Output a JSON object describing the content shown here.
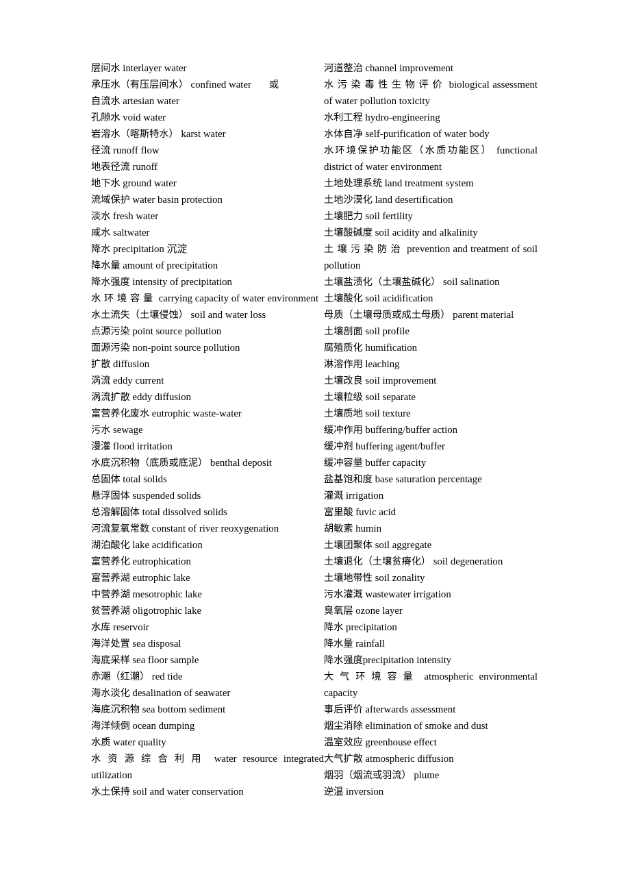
{
  "document": {
    "type": "bilingual-glossary",
    "title_visible": false,
    "page_background": "#ffffff",
    "text_color": "#000000",
    "columns": 2
  },
  "left_column": {
    "name": "left-glossary-column",
    "entries": [
      {
        "zh": "层间水",
        "en": "interlayer water"
      },
      {
        "zh": "承压水（有压层间水）",
        "en": "confined water",
        "trailing_zh": "或",
        "spread": false
      },
      {
        "zh": "自流水",
        "en": "artesian water"
      },
      {
        "zh": "孔隙水",
        "en": "void water"
      },
      {
        "zh": "岩溶水（喀斯特水）",
        "en": "karst water"
      },
      {
        "zh": "径流",
        "en": "runoff flow"
      },
      {
        "zh": "地表径流",
        "en": "runoff"
      },
      {
        "zh": "地下水",
        "en": "ground water"
      },
      {
        "zh": "流域保护",
        "en": "water basin protection"
      },
      {
        "zh": "淡水",
        "en": "fresh water"
      },
      {
        "zh": "咸水",
        "en": "saltwater"
      },
      {
        "zh": "降水",
        "en": "precipitation 沉淀"
      },
      {
        "zh": "降水量",
        "en": "amount of precipitation"
      },
      {
        "zh": "降水强度",
        "en": "intensity of precipitation"
      },
      {
        "zh": "水环境容量",
        "en": "carrying capacity of water environment",
        "spread": true
      },
      {
        "zh": "水土流失（土壤侵蚀）",
        "en": "soil and water loss"
      },
      {
        "zh": "点源污染",
        "en": "point source pollution"
      },
      {
        "zh": "面源污染",
        "en": "non-point source pollution"
      },
      {
        "zh": "扩散",
        "en": "diffusion"
      },
      {
        "zh": "涡流",
        "en": "eddy current"
      },
      {
        "zh": "涡流扩散",
        "en": "eddy diffusion"
      },
      {
        "zh": "富营养化废水",
        "en": "eutrophic waste-water"
      },
      {
        "zh": "污水",
        "en": "sewage"
      },
      {
        "zh": "漫灌",
        "en": "flood irritation"
      },
      {
        "zh": "水底沉积物（底质或底泥）",
        "en": "benthal deposit"
      },
      {
        "zh": "总固体",
        "en": "total solids"
      },
      {
        "zh": "悬浮固体",
        "en": "suspended solids"
      },
      {
        "zh": "总溶解固体",
        "en": "total dissolved solids"
      },
      {
        "zh": "河流复氧常数",
        "en": "constant of river reoxygenation"
      },
      {
        "zh": "湖泊酸化",
        "en": "lake acidification"
      },
      {
        "zh": "富营养化",
        "en": "eutrophication"
      },
      {
        "zh": "富营养湖",
        "en": "eutrophic lake"
      },
      {
        "zh": "中营养湖",
        "en": "mesotrophic lake"
      },
      {
        "zh": "贫营养湖",
        "en": "oligotrophic lake"
      },
      {
        "zh": "水库",
        "en": "reservoir"
      },
      {
        "zh": "海洋处置",
        "en": "sea disposal"
      },
      {
        "zh": "海底采样",
        "en": "sea floor sample"
      },
      {
        "zh": "赤潮（红潮）",
        "en": "red tide"
      },
      {
        "zh": "海水淡化",
        "en": "desalination of seawater"
      },
      {
        "zh": "海底沉积物",
        "en": "sea bottom sediment"
      },
      {
        "zh": "海洋倾倒",
        "en": "ocean dumping"
      },
      {
        "zh": "水质",
        "en": "water quality"
      },
      {
        "zh": "水资源综合利用",
        "en": "water resource integrated utilization",
        "spread": true
      },
      {
        "zh": "水土保持",
        "en": "soil and water conservation"
      }
    ]
  },
  "right_column": {
    "name": "right-glossary-column",
    "entries": [
      {
        "zh": "河道整治",
        "en": "channel improvement"
      },
      {
        "zh": "水污染毒性生物评价",
        "en": "biological assessment of water pollution toxicity",
        "spread": true
      },
      {
        "zh": "水利工程",
        "en": "hydro-engineering"
      },
      {
        "zh": "水体自净",
        "en": "self-purification of water body"
      },
      {
        "zh": "水环境保护功能区（水质功能区）",
        "en": "functional district of water environment"
      },
      {
        "zh": "土地处理系统",
        "en": "land treatment system"
      },
      {
        "zh": "土地沙漠化",
        "en": "land desertification"
      },
      {
        "zh": "土壤肥力",
        "en": "soil fertility"
      },
      {
        "zh": "土壤酸碱度",
        "en": "soil acidity and alkalinity"
      },
      {
        "zh": "土壤污染防治",
        "en": "prevention and treatment of soil pollution",
        "spread": true
      },
      {
        "zh": "土壤盐渍化（土壤盐碱化）",
        "en": "soil salination"
      },
      {
        "zh": "土壤酸化",
        "en": "soil acidification"
      },
      {
        "zh": "母质（土壤母质或成土母质）",
        "en": "parent material"
      },
      {
        "zh": "土壤剖面",
        "en": "soil profile"
      },
      {
        "zh": "腐殖质化",
        "en": "humification"
      },
      {
        "zh": "淋溶作用",
        "en": "leaching"
      },
      {
        "zh": "土壤改良",
        "en": "soil improvement"
      },
      {
        "zh": "土壤粒级",
        "en": "soil separate"
      },
      {
        "zh": "土壤质地",
        "en": "soil texture"
      },
      {
        "zh": "缓冲作用",
        "en": "buffering/buffer action"
      },
      {
        "zh": "缓冲剂",
        "en": "buffering agent/buffer"
      },
      {
        "zh": "缓冲容量",
        "en": "buffer capacity"
      },
      {
        "zh": "盐基饱和度",
        "en": "base saturation percentage"
      },
      {
        "zh": "灌溉",
        "en": "irrigation"
      },
      {
        "zh": "富里酸",
        "en": "fuvic acid"
      },
      {
        "zh": "胡敏素",
        "en": "humin"
      },
      {
        "zh": "土壤团聚体",
        "en": "soil aggregate"
      },
      {
        "zh": "土壤退化（土壤贫瘠化）",
        "en": "soil degeneration"
      },
      {
        "zh": "土壤地带性",
        "en": "soil zonality"
      },
      {
        "zh": "污水灌溉",
        "en": "wastewater irrigation"
      },
      {
        "zh": "臭氧层",
        "en": "ozone layer"
      },
      {
        "zh": "降水",
        "en": "precipitation"
      },
      {
        "zh": "降水量",
        "en": "rainfall"
      },
      {
        "zh": "降水强度",
        "en": "precipitation intensity",
        "no_space": true
      },
      {
        "zh": "大气环境容量",
        "en": "atmospheric environmental capacity",
        "spread": true
      },
      {
        "zh": "事后评价",
        "en": "afterwards assessment"
      },
      {
        "zh": "烟尘消除",
        "en": "elimination of smoke and dust"
      },
      {
        "zh": "温室效应",
        "en": "greenhouse effect"
      },
      {
        "zh": "大气扩散",
        "en": "atmospheric diffusion"
      },
      {
        "zh": "烟羽（烟流或羽流）",
        "en": "plume"
      },
      {
        "zh": "逆温",
        "en": "inversion"
      }
    ]
  }
}
